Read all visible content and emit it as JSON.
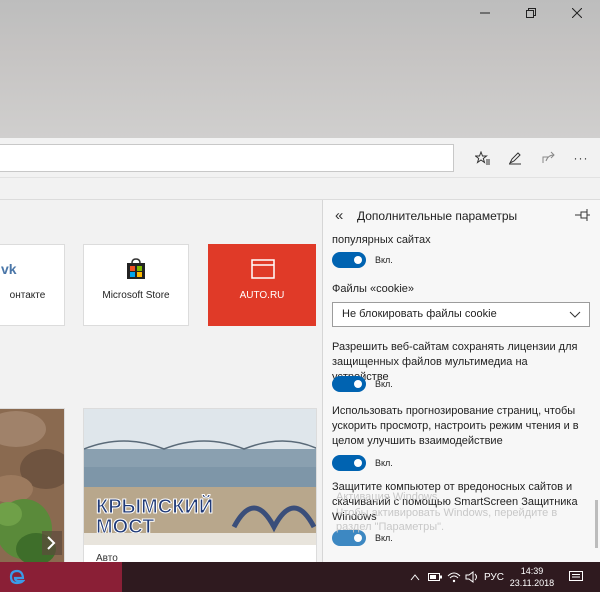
{
  "window": {
    "minimize_label": "minimize",
    "restore_label": "restore",
    "close_label": "close"
  },
  "toolbar": {
    "more_label": "···"
  },
  "tiles": [
    {
      "label": "онтакте"
    },
    {
      "label": "Microsoft Store"
    },
    {
      "label": "AUTO.RU"
    }
  ],
  "news": {
    "card_caption": "Авто",
    "image_text_line1": "КРЫМСКИЙ",
    "image_text_line2": "МОСТ"
  },
  "pane": {
    "title": "Дополнительные параметры",
    "items": {
      "popular_tail": "популярных сайтах",
      "toggle1_label": "Вкл.",
      "cookies_heading": "Файлы «cookie»",
      "cookies_value": "Не блокировать файлы cookie",
      "licenses_text": "Разрешить веб-сайтам сохранять лицензии для защищенных файлов мультимедиа на устройстве",
      "toggle2_label": "Вкл.",
      "prediction_text": "Использовать прогнозирование страниц, чтобы ускорить просмотр, настроить режим чтения и в целом улучшить взаимодействие",
      "toggle3_label": "Вкл.",
      "smartscreen_text": "Защитите компьютер от вредоносных сайтов и скачиваний с помощью SmartScreen Защитника Windows",
      "toggle4_label": "Вкл."
    }
  },
  "watermark": {
    "line1": "Активация Windows",
    "line2": "Чтобы активировать Windows, перейдите в",
    "line3": "раздел \"Параметры\"."
  },
  "taskbar": {
    "lang": "РУС",
    "time": "14:39",
    "date": "23.11.2018"
  },
  "colors": {
    "accent": "#0063b1",
    "tile_auto": "#e03a28",
    "taskbar": "#2f1a1f",
    "taskbar_active": "#8a1f36"
  }
}
